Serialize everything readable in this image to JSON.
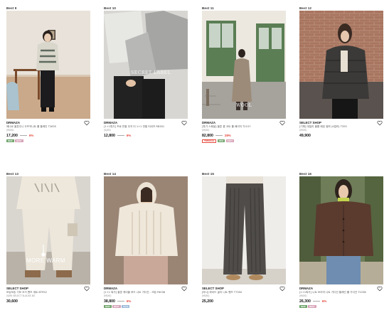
{
  "products": [
    {
      "best": "Best 9",
      "brand": "DRMAZA",
      "name": "에너르 울혼주니 오프넥니트 롤 플레인 T2835",
      "sizes": "(M/XS)",
      "price": "17,200",
      "rate": "6%",
      "tags": [
        {
          "text": "NEW",
          "color": "#6fa36a"
        },
        {
          "text": "BEST",
          "color": "#d7a3b8"
        }
      ],
      "overlay": ""
    },
    {
      "best": "Best 10",
      "brand": "DRMAZA",
      "name": "[1+1특가] 프로 반팔 무지 티 1+1 반팔 티셔츠 RB301",
      "sizes": "(S/XS)",
      "price": "12,800",
      "rate": "6%",
      "tags": [
        {
          "text": "NEW",
          "color": "#6fa36a"
        },
        {
          "text": "BEST",
          "color": "#d7a3b8"
        }
      ],
      "overlay": "SECRET LABEL"
    },
    {
      "best": "Best 11",
      "brand": "DRMAZA",
      "name": "[특가 스페셜] 울혼 롱 코트 롤 베이직 T2157",
      "sizes": "(M/XS)",
      "price": "82,800",
      "rate": "28%",
      "tags": [
        {
          "text": "TIMESALE",
          "color": "red"
        },
        {
          "text": "NEW",
          "color": "#6fa36a"
        },
        {
          "text": "BEST",
          "color": "#d7a3b8"
        }
      ],
      "overlay": "WOOL"
    },
    {
      "best": "Best 12",
      "brand": "SELECT SHOP",
      "name": "[기획] 데일리 볼륨 패딩 점퍼 (4컬러) T355",
      "sizes": "(M/XS)",
      "price": "49,900",
      "rate": "",
      "tags": [],
      "overlay": ""
    },
    {
      "best": "Best 13",
      "brand": "SELECT SHOP",
      "name": "보송보송 기모 조거 팬츠 세트 BT952",
      "sizes": "(S/M) SELECT SLACKS DS",
      "price": "30,600",
      "rate": "",
      "tags": [],
      "overlay": "MORE WARM"
    },
    {
      "best": "Best 14",
      "brand": "DRMAZA",
      "name": "[1+1 특가] 울혼 케이블 후드 니트 가디건 - 크림 F6038",
      "sizes": "(M/XS)",
      "price": "38,800",
      "rate": "6%",
      "tags": [
        {
          "text": "NEW",
          "color": "#6fa36a"
        },
        {
          "text": "BEST",
          "color": "#d7a3b8"
        },
        {
          "text": "SALE",
          "color": "#9ab8d8"
        }
      ],
      "overlay": ""
    },
    {
      "best": "Best 15",
      "brand": "SELECT SHOP",
      "name": "[마니] 와이드 골지 니트 팬츠 T7350",
      "sizes": "(M/XS)",
      "price": "25,200",
      "rate": "",
      "tags": [],
      "overlay": ""
    },
    {
      "best": "Best 16",
      "brand": "DRMAZA",
      "name": "[1+1특가] 니트 브이넥 니트 가디건 플레인 롤 가디건 T2238",
      "sizes": "(M/XS)",
      "price": "26,300",
      "rate": "6%",
      "tags": [
        {
          "text": "NEW",
          "color": "#6fa36a"
        },
        {
          "text": "BEST",
          "color": "#d7a3b8"
        }
      ],
      "overlay": ""
    }
  ]
}
